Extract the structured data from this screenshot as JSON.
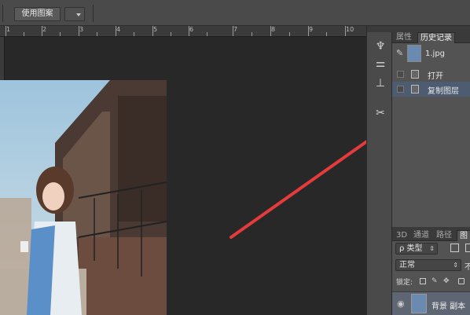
{
  "options_bar": {
    "use_pattern_button": "使用图案"
  },
  "history_panel": {
    "tabs": [
      {
        "label": "属性",
        "active": false
      },
      {
        "label": "历史记录",
        "active": true
      }
    ],
    "snapshot_name": "1.jpg",
    "steps": [
      {
        "label": "打开",
        "selected": false
      },
      {
        "label": "复制图层",
        "selected": true
      }
    ]
  },
  "layers_panel": {
    "tabs": [
      {
        "label": "3D",
        "active": false
      },
      {
        "label": "通道",
        "active": false
      },
      {
        "label": "路径",
        "active": false
      },
      {
        "label": "图层",
        "active": true
      }
    ],
    "filter_kind": "ρ 类型",
    "blend_mode": "正常",
    "opacity_label": "不",
    "lock_label": "锁定:",
    "layer_name": "背景 副本"
  },
  "colors": {
    "arrow": "#e63b3b",
    "selection": "#4e5c72"
  }
}
